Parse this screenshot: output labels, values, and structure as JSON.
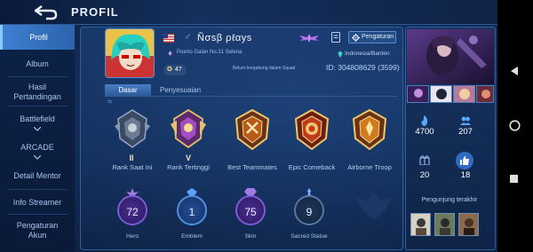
{
  "page": {
    "title": "PROFIL"
  },
  "sidebar": {
    "items": [
      {
        "label": "Profil",
        "active": true
      },
      {
        "label": "Album"
      },
      {
        "label": "Hasil Pertandingan"
      },
      {
        "label": "Battlefield"
      },
      {
        "label": "ARCADE"
      },
      {
        "label": "Detail Mentor"
      },
      {
        "label": "Info Streamer"
      },
      {
        "label": "Pengaturan Akun"
      }
    ]
  },
  "profile": {
    "name": "Ñσѕβ ρℓαуѕ",
    "address": "Puerto Galán No.31 Selena",
    "level": "47",
    "squad_status": "Belum bergabung dalam Squad",
    "location": "Indonesia/Banten",
    "id": "ID: 304808629 (3599)",
    "settings_button": "Pengaturan",
    "gender_symbol": "♂"
  },
  "tabs": [
    {
      "label": "Dasar",
      "active": true
    },
    {
      "label": "Penyesuaian"
    }
  ],
  "ranks": [
    {
      "label": "Rank Saat Ini",
      "numeral": "II"
    },
    {
      "label": "Rank Tertinggi",
      "numeral": "V"
    },
    {
      "label": "Best Teammates"
    },
    {
      "label": "Epic Comeback"
    },
    {
      "label": "Airborne Troop"
    }
  ],
  "stats": [
    {
      "label": "Hero",
      "value": "72"
    },
    {
      "label": "Emblem",
      "value": "1"
    },
    {
      "label": "Skin",
      "value": "75"
    },
    {
      "label": "Sacred Statue",
      "value": "9"
    }
  ],
  "right_stats": [
    {
      "icon": "fire-icon",
      "value": "4700"
    },
    {
      "icon": "friends-icon",
      "value": "207"
    },
    {
      "icon": "gift-icon",
      "value": "20"
    },
    {
      "icon": "like-icon",
      "value": "18"
    }
  ],
  "visitors": {
    "label": "Pengunjung terakhir"
  },
  "colors": {
    "accent": "#2d5a9b",
    "panel": "#173462",
    "gold": "#f0c66a"
  }
}
